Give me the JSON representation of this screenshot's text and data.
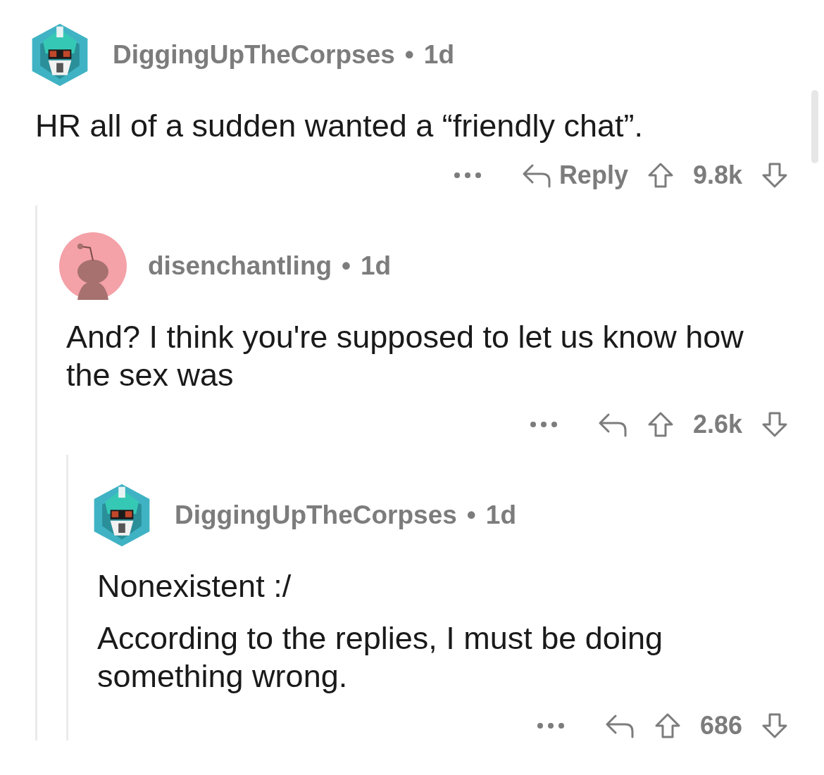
{
  "thread": [
    {
      "author": "DiggingUpTheCorpses",
      "separator": "•",
      "age": "1d",
      "avatar": {
        "kind": "robot"
      },
      "paragraphs": [
        "HR all of a sudden wanted a “friendly chat”."
      ],
      "reply_label": "Reply",
      "score": "9.8k",
      "children": [
        {
          "author": "disenchantling",
          "separator": "•",
          "age": "1d",
          "avatar": {
            "kind": "snoo"
          },
          "paragraphs": [
            "And? I think you're supposed to let us know how the sex was"
          ],
          "score": "2.6k",
          "children": [
            {
              "author": "DiggingUpTheCorpses",
              "separator": "•",
              "age": "1d",
              "avatar": {
                "kind": "robot"
              },
              "paragraphs": [
                "Nonexistent :/",
                "According to the replies, I must be doing something wrong."
              ],
              "score": "686"
            }
          ]
        }
      ]
    }
  ]
}
